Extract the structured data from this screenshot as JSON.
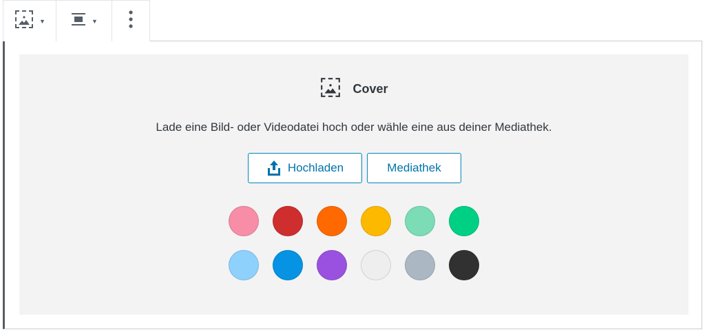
{
  "toolbar": {
    "icons": [
      "cover-image-icon",
      "align-center-icon",
      "more-vertical-icon"
    ]
  },
  "placeholder": {
    "label": "Cover",
    "instructions": "Lade eine Bild- oder Videodatei hoch oder wähle eine aus deiner Mediathek.",
    "upload_label": "Hochladen",
    "media_label": "Mediathek"
  },
  "colors": [
    "#f78da7",
    "#cf2e2e",
    "#ff6900",
    "#fcb900",
    "#7bdcb5",
    "#00d084",
    "#8ed1fc",
    "#0693e3",
    "#9b51e0",
    "#eeeeee",
    "#abb8c3",
    "#313131"
  ],
  "accent": "#0073aa"
}
